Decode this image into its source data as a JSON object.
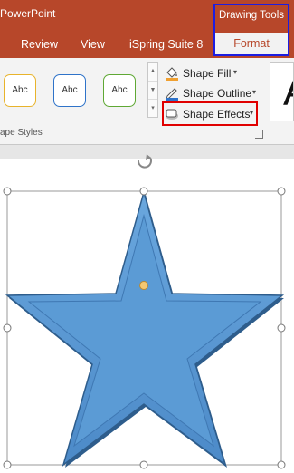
{
  "titlebar": {
    "app_title": "PowerPoint"
  },
  "tabs": [
    {
      "label": "Review"
    },
    {
      "label": "View"
    },
    {
      "label": "iSpring Suite 8"
    }
  ],
  "context_tabs": {
    "group_label": "Drawing Tools",
    "format_label": "Format"
  },
  "ribbon": {
    "shape_styles": {
      "preview_text": [
        "Abc",
        "Abc",
        "Abc"
      ],
      "group_label": "ape Styles"
    },
    "commands": {
      "shape_fill": "Shape Fill",
      "shape_outline": "Shape Outline",
      "shape_effects": "Shape Effects"
    },
    "wordart_preview": "A"
  },
  "colors": {
    "accent": "#b7472a",
    "context_highlight": "#1d1de0",
    "callout_highlight": "#e00000",
    "star_fill": "#5b9bd5",
    "star_stroke": "#2e5d8c"
  },
  "icons": [
    "paint-bucket-icon",
    "pen-outline-icon",
    "shape-effects-icon",
    "rotate-handle-icon",
    "dialog-launcher-icon"
  ]
}
